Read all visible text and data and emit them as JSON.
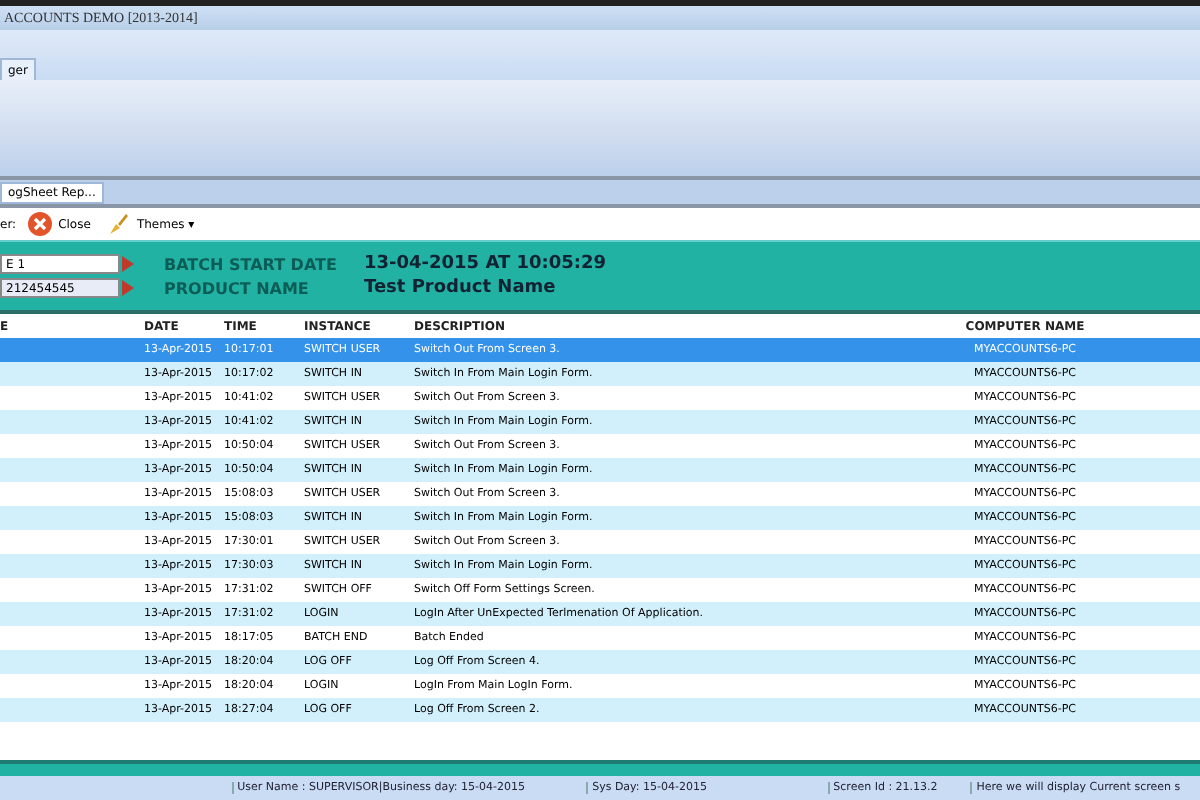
{
  "window": {
    "title": "ACCOUNTS DEMO [2013-2014]"
  },
  "tabs": [
    {
      "label": "ger",
      "selected": true
    }
  ],
  "document_tabs": [
    {
      "label": "ogSheet Rep...",
      "selected": true
    }
  ],
  "toolbar": {
    "label": "er:",
    "buttons": [
      {
        "label": "Close",
        "kind": "close"
      },
      {
        "label": "Themes ▾",
        "kind": "themes"
      }
    ]
  },
  "header_panel": {
    "fields": [
      {
        "value": "E 1"
      },
      {
        "value": "212454545"
      }
    ],
    "info": [
      {
        "label": "BATCH START DATE",
        "value": "13-04-2015 AT 10:05:29"
      },
      {
        "label": "PRODUCT NAME",
        "value": "Test Product Name"
      }
    ]
  },
  "table": {
    "columns": [
      "E",
      "DATE",
      "TIME",
      "INSTANCE",
      "DESCRIPTION",
      "COMPUTER NAME"
    ],
    "rows": [
      {
        "cells": [
          "",
          "13-Apr-2015",
          "10:17:01",
          "SWITCH USER",
          "Switch Out From Screen 3.",
          "MYACCOUNTS6-PC"
        ],
        "selected": true
      },
      {
        "cells": [
          "",
          "13-Apr-2015",
          "10:17:02",
          "SWITCH IN",
          "Switch In From Main Login Form.",
          "MYACCOUNTS6-PC"
        ],
        "selected": false
      },
      {
        "cells": [
          "",
          "13-Apr-2015",
          "10:41:02",
          "SWITCH USER",
          "Switch Out From Screen 3.",
          "MYACCOUNTS6-PC"
        ],
        "selected": false
      },
      {
        "cells": [
          "",
          "13-Apr-2015",
          "10:41:02",
          "SWITCH IN",
          "Switch In From Main Login Form.",
          "MYACCOUNTS6-PC"
        ],
        "selected": false
      },
      {
        "cells": [
          "",
          "13-Apr-2015",
          "10:50:04",
          "SWITCH USER",
          "Switch Out From Screen 3.",
          "MYACCOUNTS6-PC"
        ],
        "selected": false
      },
      {
        "cells": [
          "",
          "13-Apr-2015",
          "10:50:04",
          "SWITCH IN",
          "Switch In From Main Login Form.",
          "MYACCOUNTS6-PC"
        ],
        "selected": false
      },
      {
        "cells": [
          "",
          "13-Apr-2015",
          "15:08:03",
          "SWITCH USER",
          "Switch Out From Screen 3.",
          "MYACCOUNTS6-PC"
        ],
        "selected": false
      },
      {
        "cells": [
          "",
          "13-Apr-2015",
          "15:08:03",
          "SWITCH IN",
          "Switch In From Main Login Form.",
          "MYACCOUNTS6-PC"
        ],
        "selected": false
      },
      {
        "cells": [
          "",
          "13-Apr-2015",
          "17:30:01",
          "SWITCH USER",
          "Switch Out From Screen 3.",
          "MYACCOUNTS6-PC"
        ],
        "selected": false
      },
      {
        "cells": [
          "",
          "13-Apr-2015",
          "17:30:03",
          "SWITCH IN",
          "Switch In From Main Login Form.",
          "MYACCOUNTS6-PC"
        ],
        "selected": false
      },
      {
        "cells": [
          "",
          "13-Apr-2015",
          "17:31:02",
          "SWITCH OFF",
          "Switch Off Form Settings Screen.",
          "MYACCOUNTS6-PC"
        ],
        "selected": false
      },
      {
        "cells": [
          "",
          "13-Apr-2015",
          "17:31:02",
          "LOGIN",
          "LogIn After UnExpected Terlmenation Of Application.",
          "MYACCOUNTS6-PC"
        ],
        "selected": false
      },
      {
        "cells": [
          "",
          "13-Apr-2015",
          "18:17:05",
          "BATCH END",
          "Batch Ended",
          "MYACCOUNTS6-PC"
        ],
        "selected": false
      },
      {
        "cells": [
          "",
          "13-Apr-2015",
          "18:20:04",
          "LOG OFF",
          "Log Off  From Screen 4.",
          "MYACCOUNTS6-PC"
        ],
        "selected": false
      },
      {
        "cells": [
          "",
          "13-Apr-2015",
          "18:20:04",
          "LOGIN",
          "LogIn From Main LogIn Form.",
          "MYACCOUNTS6-PC"
        ],
        "selected": false
      },
      {
        "cells": [
          "",
          "13-Apr-2015",
          "18:27:04",
          "LOG OFF",
          "Log Off  From Screen 2.",
          "MYACCOUNTS6-PC"
        ],
        "selected": false
      }
    ]
  },
  "status_bar": [
    "User Name : SUPERVISOR|Business day: 15-04-2015",
    "Sys Day: 15-04-2015",
    "Screen Id : 21.13.2",
    "Here we will display Current screen s"
  ]
}
